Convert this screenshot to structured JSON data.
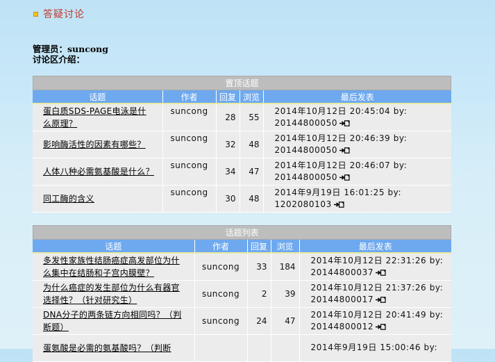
{
  "page": {
    "heading": "答疑讨论",
    "admin_label": "管理员：",
    "admin_name": "suncong",
    "intro_label": "讨论区介绍："
  },
  "pinned": {
    "title": "置顶话题",
    "headers": {
      "topic": "话题",
      "author": "作者",
      "replies": "回复",
      "views": "浏览",
      "last": "最后发表"
    },
    "rows": [
      {
        "line1": "蛋白质SDS-PAGE电泳是什",
        "line2": "么原理？",
        "author": "suncong",
        "replies": "28",
        "views": "55",
        "last_time": "2014年10月12日  20:45:04  by:",
        "last_by": "20144800050"
      },
      {
        "line1": "影响酶活性的因素有哪些？",
        "line2": "",
        "author": "suncong",
        "replies": "32",
        "views": "48",
        "last_time": "2014年10月12日  20:46:39  by:",
        "last_by": "20144800050"
      },
      {
        "line1": "人体八种必需氨基酸是什么？",
        "line2": "",
        "author": "suncong",
        "replies": "34",
        "views": "47",
        "last_time": "2014年10月12日  20:46:07  by:",
        "last_by": "20144800050"
      },
      {
        "line1": "同工酶的含义",
        "line2": "",
        "author": "suncong",
        "replies": "30",
        "views": "48",
        "last_time": "2014年9月19日  16:01:25  by:",
        "last_by": "1202080103"
      }
    ]
  },
  "list": {
    "title": "话题列表",
    "headers": {
      "topic": "话题",
      "author": "作者",
      "replies": "回复",
      "views": "浏览",
      "last": "最后发表"
    },
    "rows": [
      {
        "line1": "多发性家族性结肠癌症高发部位为什",
        "line2": "么集中在结肠和子宫内膜壁？",
        "author": "suncong",
        "replies": "33",
        "views": "184",
        "last_time": "2014年10月12日  22:31:26  by:",
        "last_by": "20144800037"
      },
      {
        "line1": "为什么癌症的发生部位为什么有器官",
        "line2": "选择性？（针对研究生）",
        "author": "suncong",
        "replies": "2",
        "views": "39",
        "last_time": "2014年10月12日  21:37:26  by:",
        "last_by": "20144800017"
      },
      {
        "line1": "DNA分子的两条链方向相同吗？（判",
        "line2": "断题）",
        "author": "suncong",
        "replies": "24",
        "views": "47",
        "last_time": "2014年10月12日  20:41:49  by:",
        "last_by": "20144800012"
      },
      {
        "line1": "蛋氨酸是必需的氨基酸吗？（判断",
        "line2": "",
        "author": "",
        "replies": "",
        "views": "",
        "last_time": "2014年9月19日  15:00:46  by:",
        "last_by": ""
      }
    ]
  },
  "icons": {
    "last_post": "arrow-into-page-icon"
  },
  "colors": {
    "header_blue": "#6ea9ef",
    "title_gray": "#bdbdbd",
    "heading_red": "#c0392b",
    "bullet_yellow": "#f3c21b"
  }
}
